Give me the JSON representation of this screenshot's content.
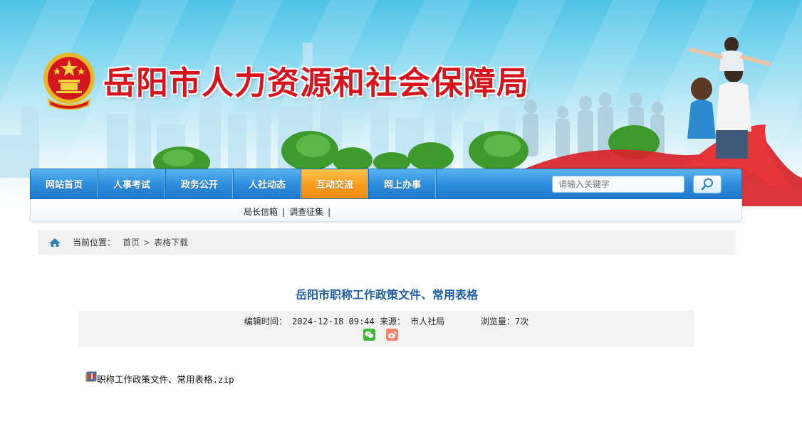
{
  "header": {
    "site_title": "岳阳市人力资源和社会保障局"
  },
  "nav": {
    "items": [
      {
        "label": "网站首页",
        "active": false
      },
      {
        "label": "人事考试",
        "active": false
      },
      {
        "label": "政务公开",
        "active": false
      },
      {
        "label": "人社动态",
        "active": false
      },
      {
        "label": "互动交流",
        "active": true
      },
      {
        "label": "网上办事",
        "active": false
      }
    ],
    "search_placeholder": "请输入关键字",
    "active_color": "#f79a1b",
    "bar_color": "#2f8fde"
  },
  "subnav": {
    "links": [
      "局长信箱",
      "调查征集"
    ],
    "separator": "|"
  },
  "breadcrumb": {
    "label": "当前位置：",
    "items": [
      "首页",
      "表格下载"
    ],
    "separator": ">"
  },
  "article": {
    "title": "岳阳市职称工作政策文件、常用表格",
    "meta": {
      "edit_time_label": "编辑时间：",
      "edit_time": "2024-12-18 09:44",
      "source_label": "来源：",
      "source": "市人社局",
      "views_label": "浏览量：",
      "views": "7次"
    },
    "share": [
      "wechat-icon",
      "weibo-icon"
    ],
    "attachment": "职称工作政策文件、常用表格.zip"
  }
}
